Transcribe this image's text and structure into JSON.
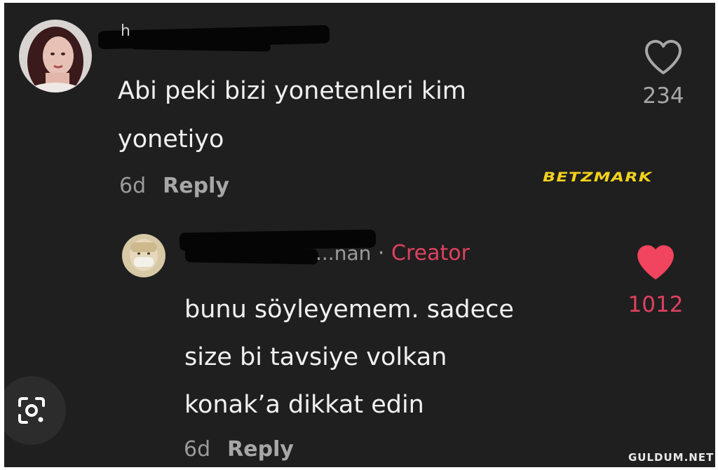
{
  "comment": {
    "username_visible": "h",
    "text_lines": [
      "Abi peki bizi yonetenleri kim",
      "yonetiyo"
    ],
    "age": "6d",
    "reply_label": "Reply",
    "like_count": "234",
    "liked": false
  },
  "reply": {
    "username_visible": "...nan",
    "separator": "·",
    "badge": "Creator",
    "text_lines": [
      "bunu söyleyemem. sadece",
      "size bi tavsiye volkan",
      "konak’a dikkat edin"
    ],
    "age": "6d",
    "reply_label": "Reply",
    "like_count": "1012",
    "liked": true
  },
  "watermarks": {
    "betmark": "BETZMARK",
    "site": "GULDUM.NET"
  },
  "colors": {
    "background": "#1f1f1f",
    "creator_accent": "#e0405f",
    "liked_heart": "#f0445f",
    "betmark": "#f2d21e"
  },
  "icons": {
    "comment_like": "heart-outline-icon",
    "reply_like": "heart-filled-icon",
    "lens": "google-lens-icon"
  }
}
